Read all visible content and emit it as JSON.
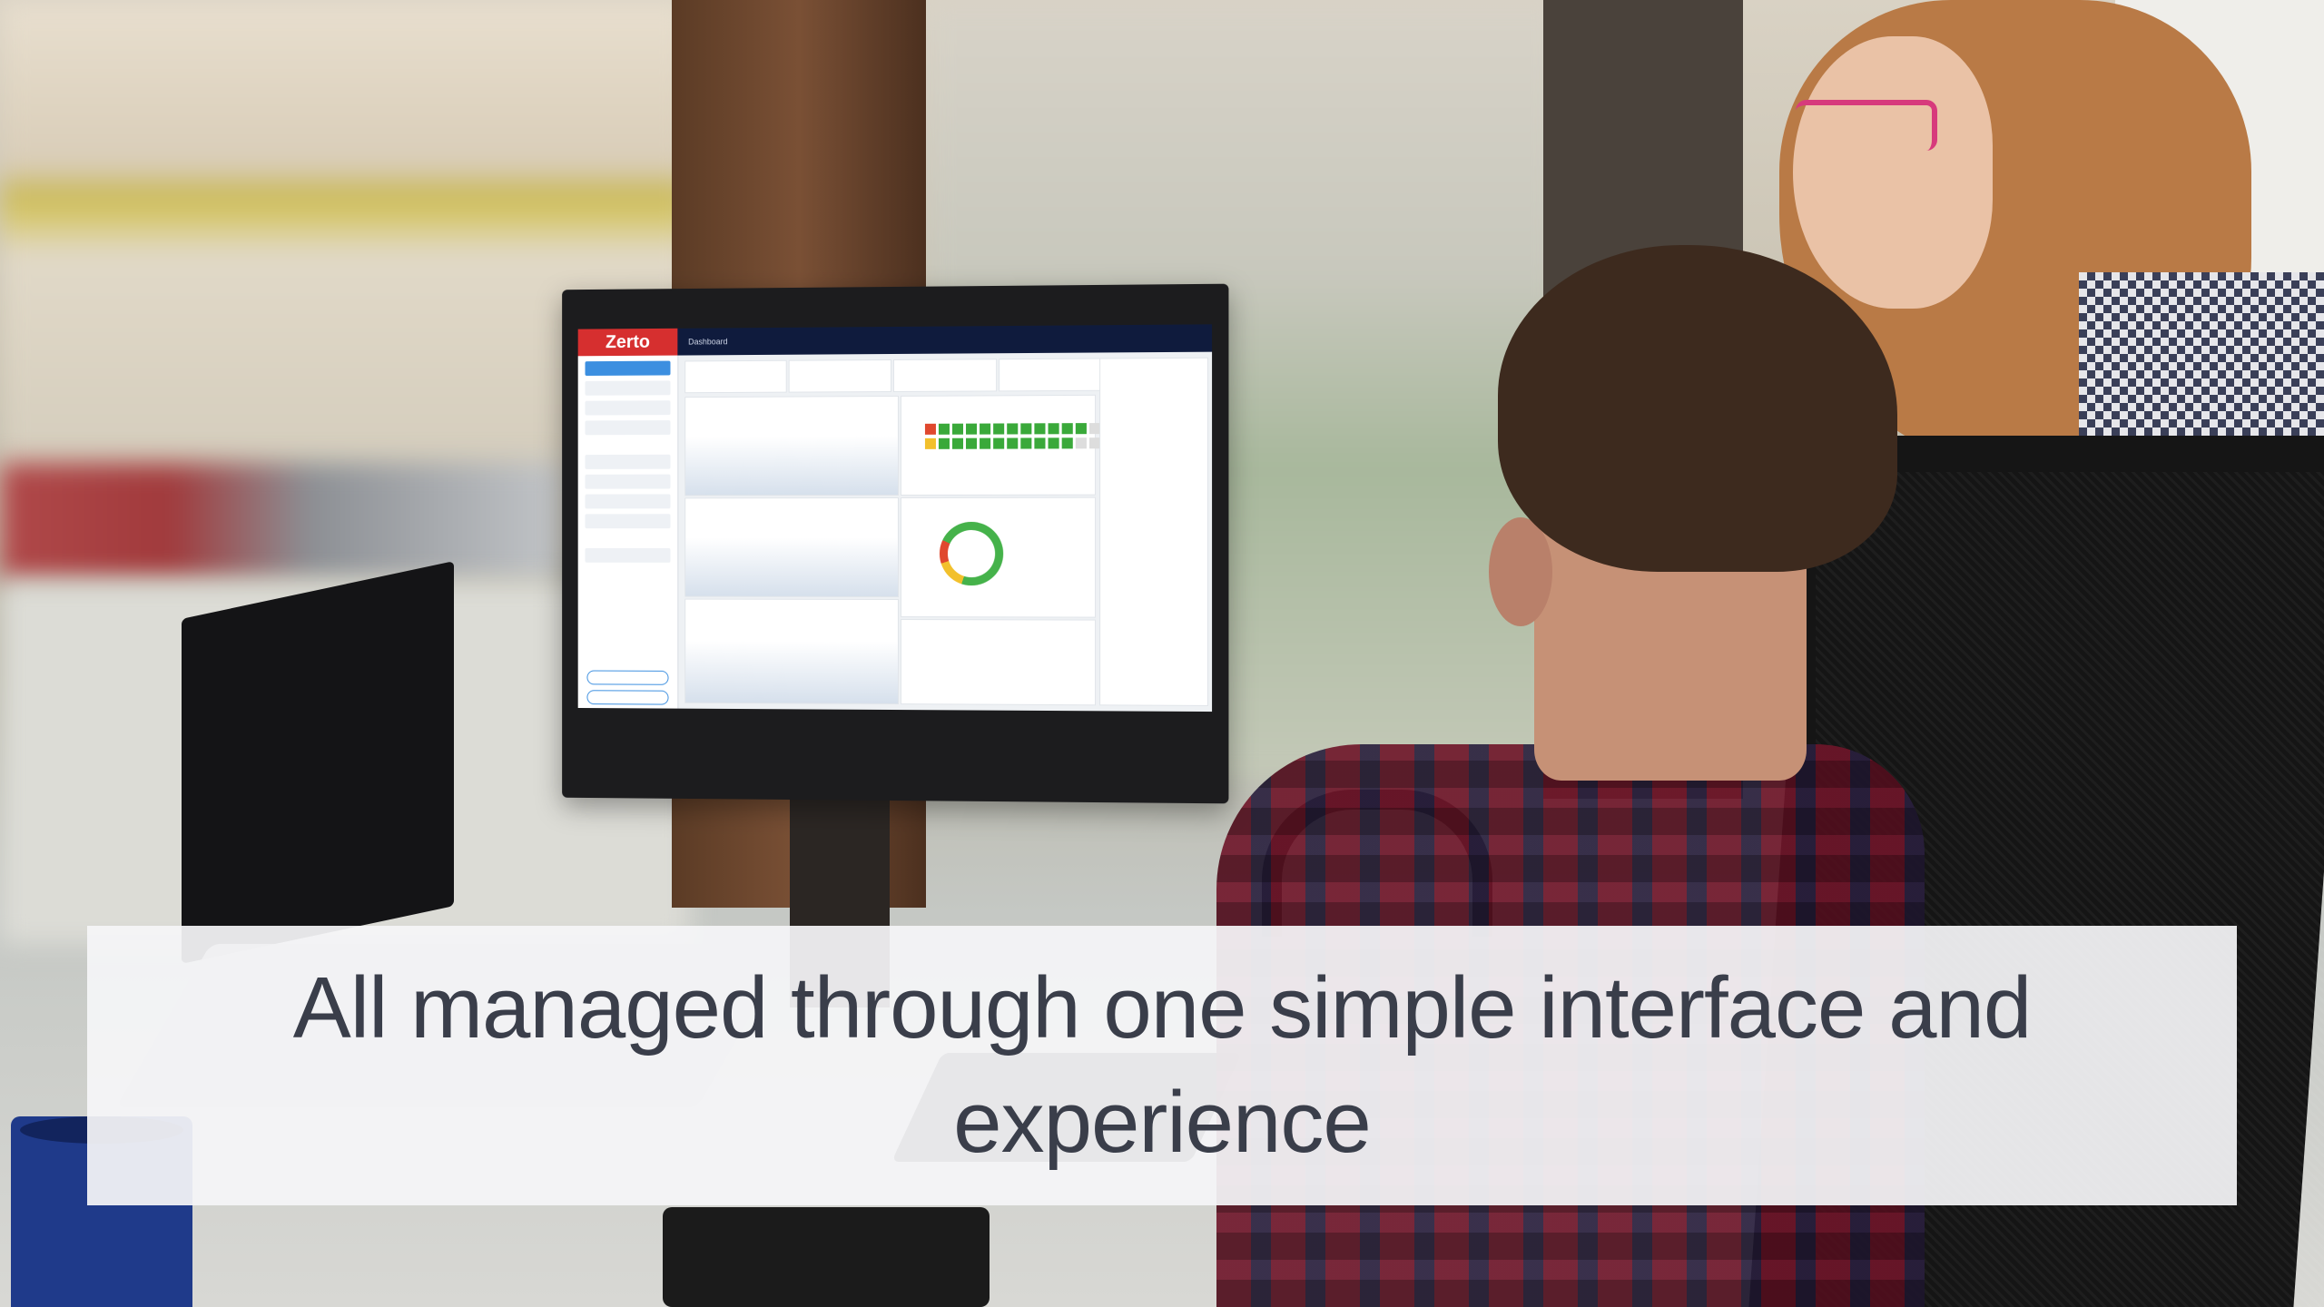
{
  "image": {
    "caption": "All managed through one simple interface and experience"
  },
  "dashboard": {
    "brand": "Zerto",
    "breadcrumb": "Dashboard"
  },
  "colors": {
    "caption_background": "#f5f5f7",
    "caption_text": "#3a3e4a",
    "brand_red": "#d62f2f",
    "nav_dark": "#0f1b3d",
    "status_green": "#3aa93a"
  }
}
